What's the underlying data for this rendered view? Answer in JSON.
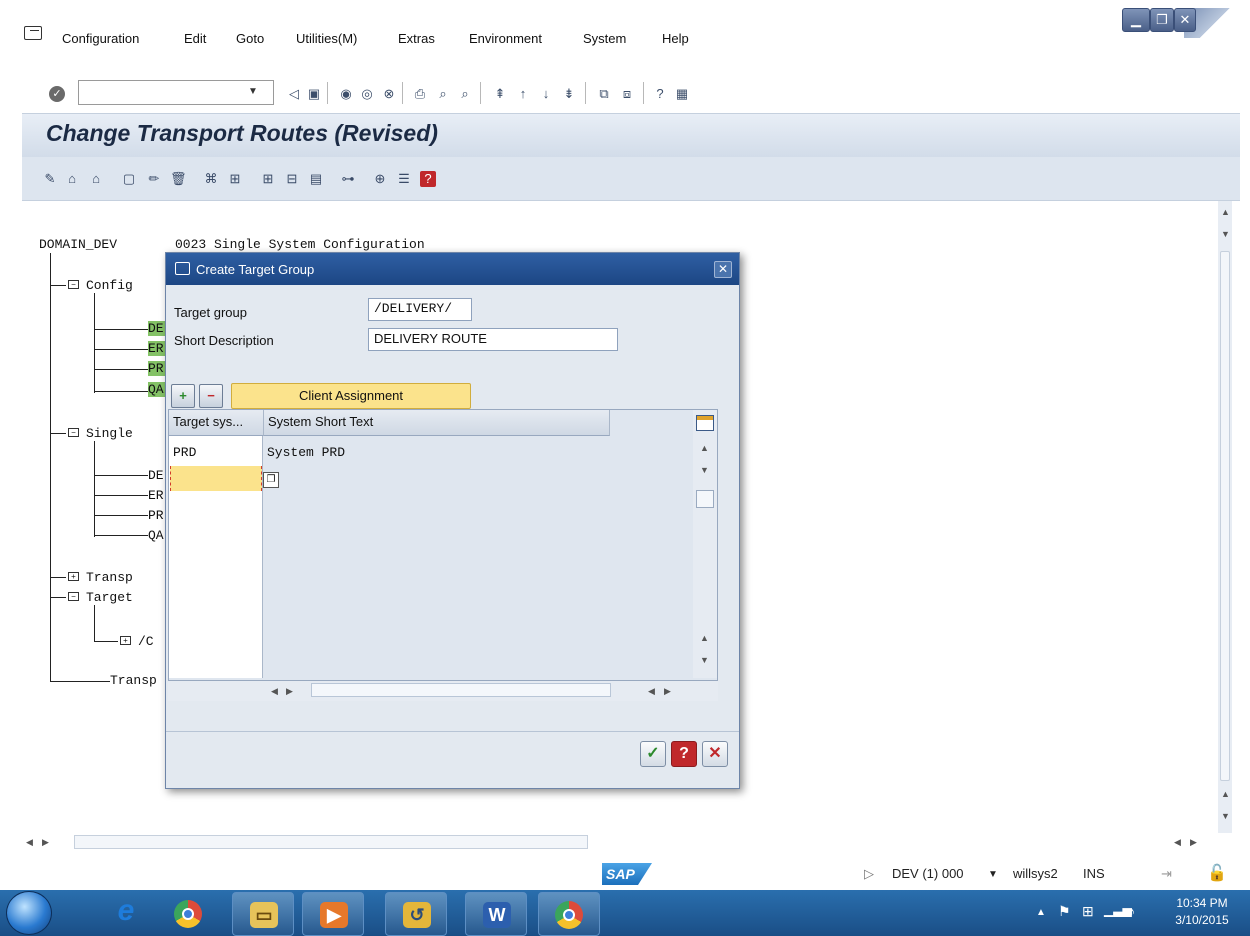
{
  "menu": {
    "items": [
      {
        "label": "Configuration"
      },
      {
        "label": "Edit"
      },
      {
        "label": "Goto"
      },
      {
        "label": "Utilities(M)"
      },
      {
        "label": "Extras"
      },
      {
        "label": "Environment"
      },
      {
        "label": "System"
      },
      {
        "label": "Help"
      }
    ]
  },
  "command_field": {
    "value": ""
  },
  "page": {
    "title": "Change Transport Routes (Revised)"
  },
  "tree": {
    "domain": "DOMAIN_DEV",
    "domain_desc": "0023 Single System Configuration",
    "nodes": [
      {
        "label": "Config"
      },
      {
        "label": "DE"
      },
      {
        "label": "ER"
      },
      {
        "label": "PR"
      },
      {
        "label": "QA"
      },
      {
        "label": "Single"
      },
      {
        "label": "DE"
      },
      {
        "label": "ER"
      },
      {
        "label": "PR"
      },
      {
        "label": "QA"
      },
      {
        "label": "Transp"
      },
      {
        "label": "Target"
      },
      {
        "label": "/C"
      },
      {
        "label": "Transp"
      }
    ]
  },
  "dialog": {
    "title": "Create Target Group",
    "fields": [
      {
        "label": "Target group",
        "value": "/DELIVERY/"
      },
      {
        "label": "Short Description",
        "value": "DELIVERY ROUTE"
      }
    ],
    "client_assignment_label": "Client Assignment",
    "grid": {
      "columns": [
        "Target sys...",
        "System Short Text"
      ],
      "rows": [
        {
          "target_sys": "PRD",
          "short_text": "System PRD"
        }
      ],
      "edit_value": ""
    }
  },
  "status": {
    "session": "DEV (1) 000",
    "server": "willsys2",
    "mode": "INS"
  },
  "taskbar": {
    "time": "10:34 PM",
    "date": "3/10/2015"
  },
  "colors": {
    "dialog_title": "#2f5fa3",
    "highlight": "#fbe38c",
    "tree_highlight": "#84c266",
    "taskbar": "#1a4e86"
  }
}
